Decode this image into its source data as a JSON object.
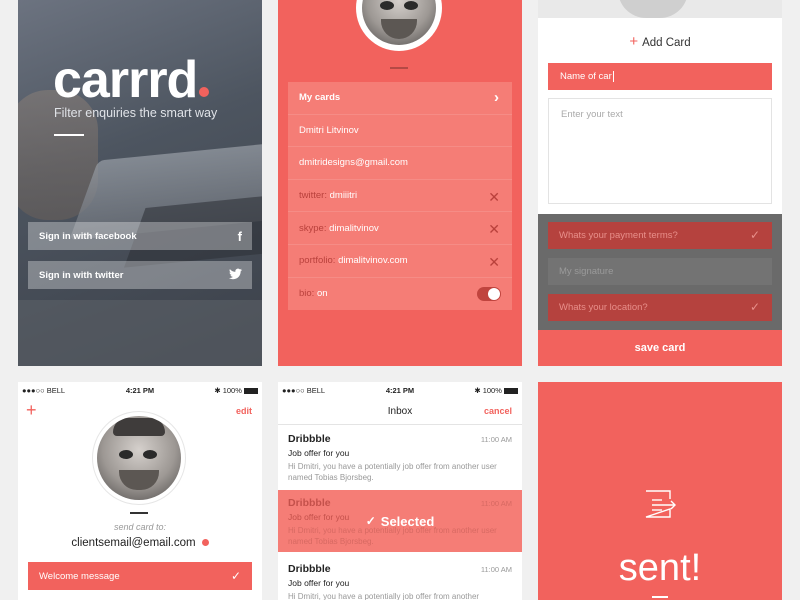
{
  "splash": {
    "logo": "carrrd",
    "tagline": "Filter enquiries the smart way",
    "facebook_label": "Sign in with facebook",
    "twitter_label": "Sign in with twitter",
    "facebook_icon": "facebook-icon",
    "twitter_icon": "twitter-icon"
  },
  "profile": {
    "rows": [
      {
        "key": "",
        "value": "My cards"
      },
      {
        "key": "",
        "value": "Dmitri Litvinov"
      },
      {
        "key": "",
        "value": "dmitridesigns@gmail.com"
      },
      {
        "key": "twitter:",
        "value": "dmiiitri"
      },
      {
        "key": "skype:",
        "value": "dimalitvinov"
      },
      {
        "key": "portfolio:",
        "value": "dimalitvinov.com"
      },
      {
        "key": "bio:",
        "value": "on"
      }
    ],
    "bio_toggle": "on"
  },
  "add_card": {
    "title": "Add Card",
    "name_value": "Name of car",
    "text_placeholder": "Enter your text",
    "questions": [
      {
        "label": "Whats your payment terms?",
        "checked": true
      },
      {
        "label": "My signature",
        "checked": false
      },
      {
        "label": "Whats your location?",
        "checked": true
      }
    ],
    "save_label": "save card"
  },
  "status_bar": {
    "carrier": "●●●○○ BELL",
    "time": "4:21 PM",
    "battery": "100%"
  },
  "send": {
    "edit_label": "edit",
    "send_to_label": "send card to:",
    "email": "clientsemail@email.com",
    "message_label": "Welcome message"
  },
  "inbox": {
    "title": "Inbox",
    "cancel_label": "cancel",
    "selected_label": "Selected",
    "messages": [
      {
        "from": "Dribbble",
        "time": "11:00 AM",
        "subject": "Job offer for you",
        "preview": "Hi Dmitri, you have a potentially job offer from another user named Tobias Bjorsbeg."
      },
      {
        "from": "Dribbble",
        "time": "11:00 AM",
        "subject": "Job offer for you",
        "preview": "Hi Dmitri, you have a potentially job offer from another user named Tobias Bjorsbeg."
      },
      {
        "from": "Dribbble",
        "time": "11:00 AM",
        "subject": "Job offer for you",
        "preview": "Hi Dmitri, you have a potentially job offer from another"
      }
    ]
  },
  "sent_screen": {
    "label": "sent!",
    "icon": "message-sent-icon"
  },
  "colors": {
    "accent": "#f2625d",
    "accent_light": "#f57d76",
    "accent_dark": "#b5423e"
  }
}
